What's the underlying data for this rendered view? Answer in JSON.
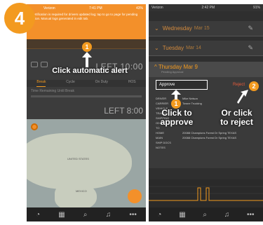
{
  "step_number": "4",
  "left_phone": {
    "status": {
      "carrier": "Verizon",
      "time": "7:41 PM",
      "battery": "43%"
    },
    "banner_text": "Certification is required for drivers updated log; tap to go to page for pending action. Manual logs generated in edit tab.",
    "left_label_1": "LEFT 10:00",
    "tabs": [
      "Break",
      "Cycle",
      "On Duty",
      "HOS"
    ],
    "time_remaining_label": "Time Remaining Until Break",
    "left_label_2": "LEFT 8:00",
    "map_label": "UNITED STATES",
    "map_label_2": "MEXICO",
    "nav_icons": [
      "dashboard-icon",
      "calendar-icon",
      "search-icon",
      "bell-icon",
      "more-icon"
    ]
  },
  "callout_1": {
    "number": "1",
    "text": "Click automatic alert"
  },
  "right_phone": {
    "status": {
      "carrier": "Verizon",
      "time": "2:42 PM",
      "battery": "91%"
    },
    "days": [
      {
        "name": "Wednesday",
        "date": "Mar 15"
      },
      {
        "name": "Tuesday",
        "date": "Mar 14"
      }
    ],
    "thursday": {
      "name": "Thursday",
      "date": "Mar 9",
      "sub": "Pending Approval"
    },
    "approve_label": "Approve",
    "reject_label": "Reject",
    "detail_labels": [
      "DRIVER",
      "CARRIER",
      "VEHICLE",
      "TRAILER",
      "SHIPPING",
      "ODO",
      "TO",
      "HOME",
      "MAIN",
      "SHIP DOCS",
      "NOTES"
    ],
    "detail_values": [
      "Mike Nelson",
      "Towne Trucking",
      "",
      "",
      "",
      "",
      "",
      "",
      "",
      "",
      ""
    ],
    "home_value": "20088 Champions Forest Dr Spring TEXAS",
    "main_value": "20088 Champions Forest Dr Spring TEXAS"
  },
  "callout_1b": {
    "number": "1",
    "text_line1": "Click to",
    "text_line2": "approve"
  },
  "callout_2": {
    "number": "2",
    "text_line1": "Or click",
    "text_line2": "to reject"
  }
}
